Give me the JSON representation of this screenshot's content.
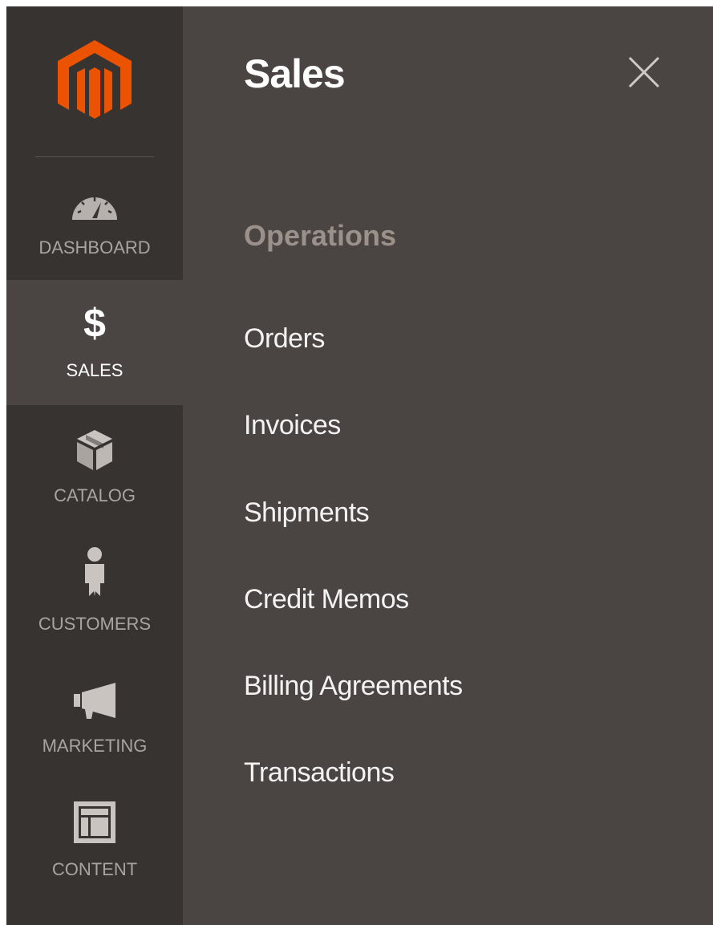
{
  "sidebar": {
    "logo_icon": "magento-logo-icon",
    "items": [
      {
        "label": "DASHBOARD",
        "icon": "dashboard-gauge-icon"
      },
      {
        "label": "SALES",
        "icon": "dollar-icon",
        "active": true
      },
      {
        "label": "CATALOG",
        "icon": "box-icon"
      },
      {
        "label": "CUSTOMERS",
        "icon": "person-icon"
      },
      {
        "label": "MARKETING",
        "icon": "megaphone-icon"
      },
      {
        "label": "CONTENT",
        "icon": "layout-icon"
      }
    ]
  },
  "panel": {
    "title": "Sales",
    "close_icon": "close-icon",
    "section_title": "Operations",
    "items": [
      "Orders",
      "Invoices",
      "Shipments",
      "Credit Memos",
      "Billing Agreements",
      "Transactions"
    ]
  },
  "colors": {
    "sidebar_bg": "#373330",
    "panel_bg": "#4a4542",
    "brand_orange": "#eb5202",
    "section_title": "#9b918a"
  }
}
